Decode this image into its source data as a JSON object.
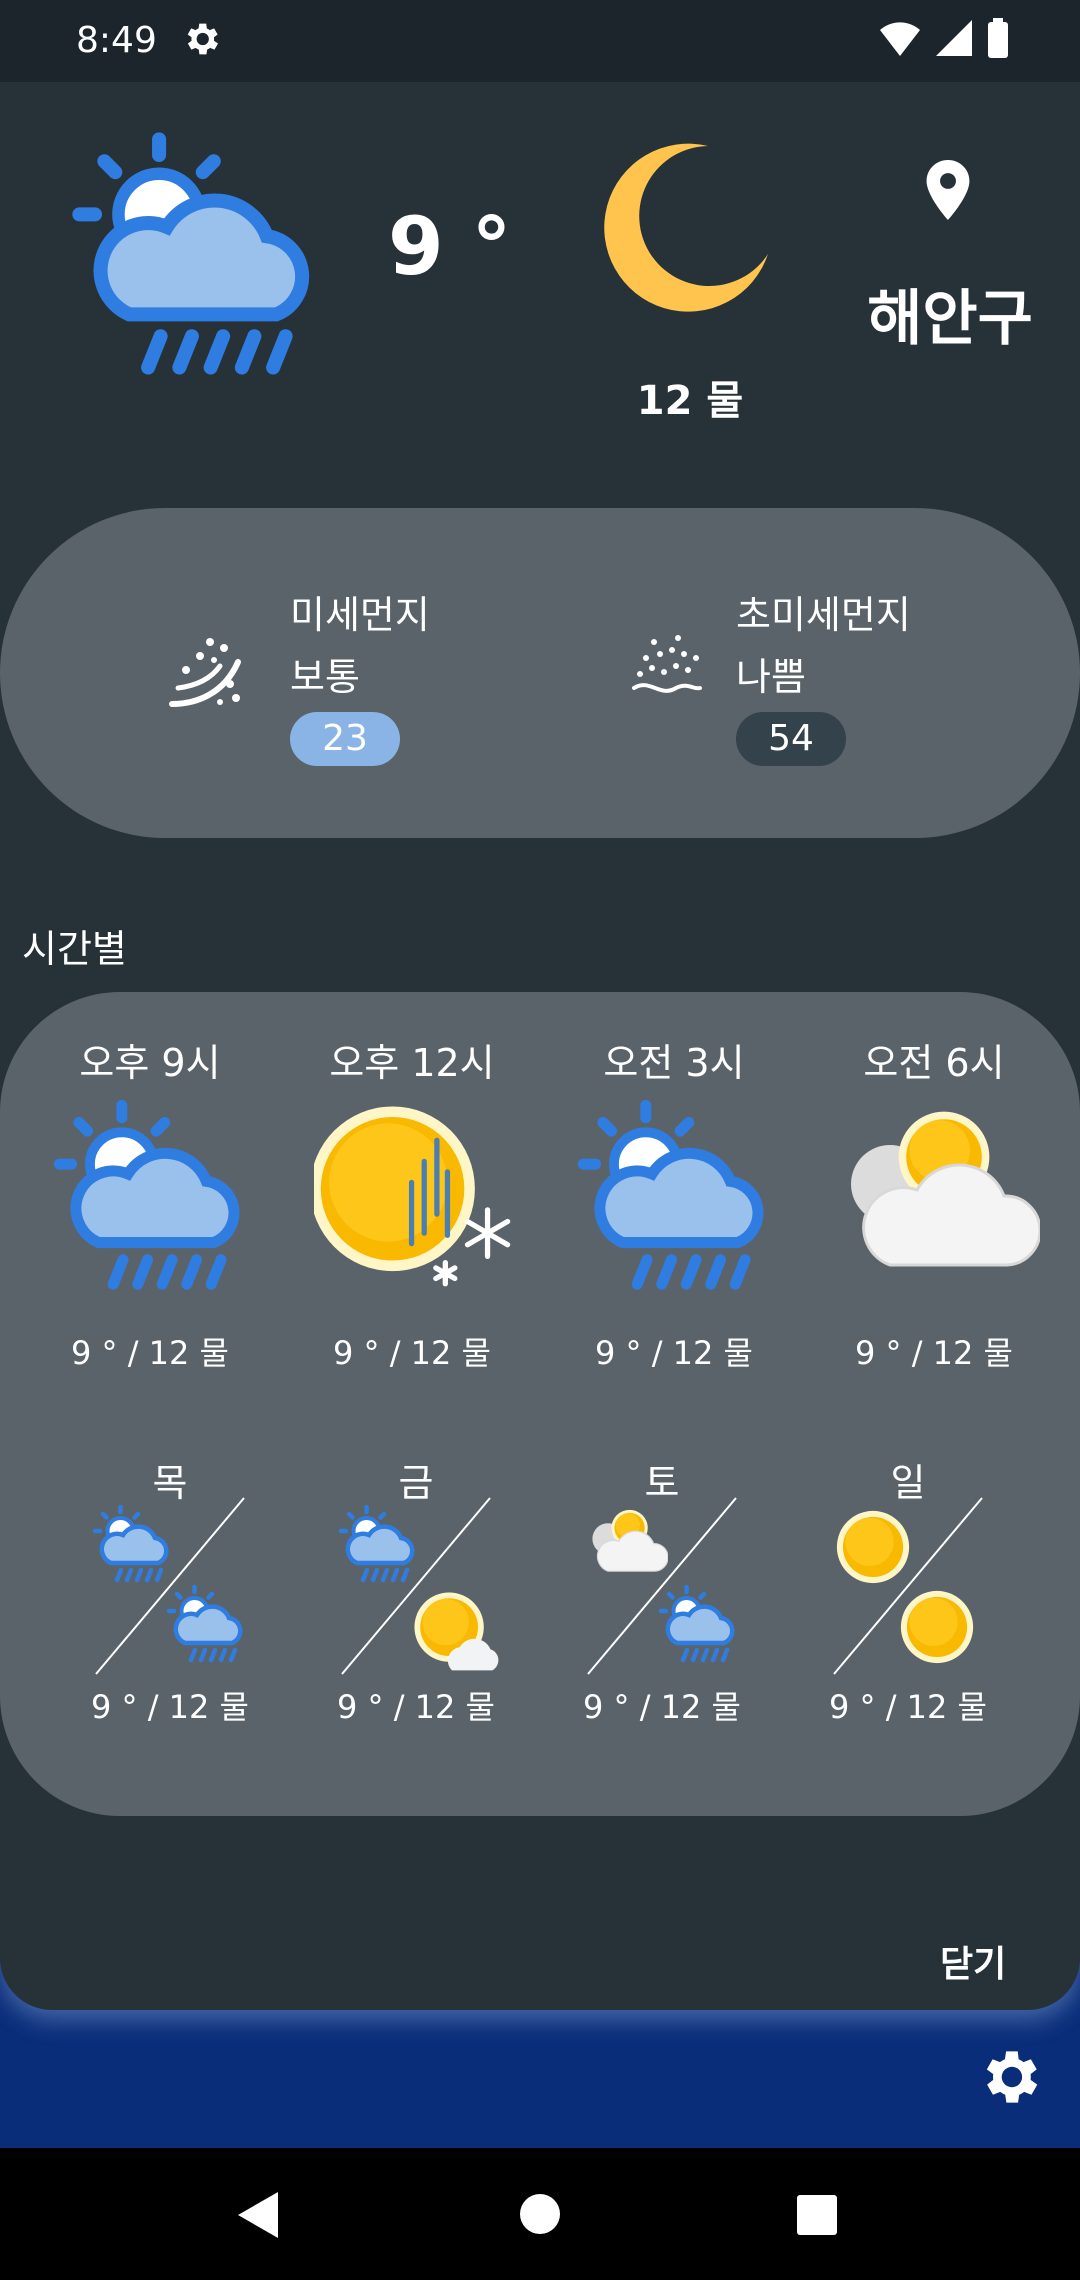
{
  "status_bar": {
    "time": "8:49"
  },
  "current": {
    "temperature": "9 °",
    "weather_icon": "sun-cloud-rain-icon",
    "moon_icon": "crescent-moon-icon",
    "moon_text": "12 물",
    "location": "해안구"
  },
  "dust": {
    "pm10": {
      "title": "미세먼지",
      "status": "보통",
      "value": "23",
      "color": "#8ab4e6"
    },
    "pm25": {
      "title": "초미세먼지",
      "status": "나쁨",
      "value": "54",
      "color": "#34424c"
    }
  },
  "hourly_title": "시간별",
  "hourly": [
    {
      "time": "오후 9시",
      "icon": "sun-cloud-rain-icon",
      "temp": "9 ° / 12 물"
    },
    {
      "time": "오후 12시",
      "icon": "sun-rain-snow-icon",
      "temp": "9 ° / 12 물"
    },
    {
      "time": "오전 3시",
      "icon": "sun-cloud-rain-icon",
      "temp": "9 ° / 12 물"
    },
    {
      "time": "오전 6시",
      "icon": "sun-cloud-icon",
      "temp": "9 ° / 12 물"
    }
  ],
  "daily": [
    {
      "day": "목",
      "am_icon": "sun-cloud-rain-icon",
      "pm_icon": "sun-cloud-rain-icon",
      "temp": "9 ° / 12 물"
    },
    {
      "day": "금",
      "am_icon": "sun-cloud-rain-icon",
      "pm_icon": "sun-cloud-icon",
      "temp": "9 ° / 12 물"
    },
    {
      "day": "토",
      "am_icon": "sun-cloud-icon",
      "pm_icon": "sun-cloud-rain-icon",
      "temp": "9 ° / 12 물"
    },
    {
      "day": "일",
      "am_icon": "sun-icon",
      "pm_icon": "sun-icon",
      "temp": "9 ° / 12 물"
    }
  ],
  "close_label": "닫기",
  "colors": {
    "sheet": "#263238",
    "card": "#5a6369",
    "accent_blue": "#2f7de1",
    "background": "#0a2d7a"
  }
}
